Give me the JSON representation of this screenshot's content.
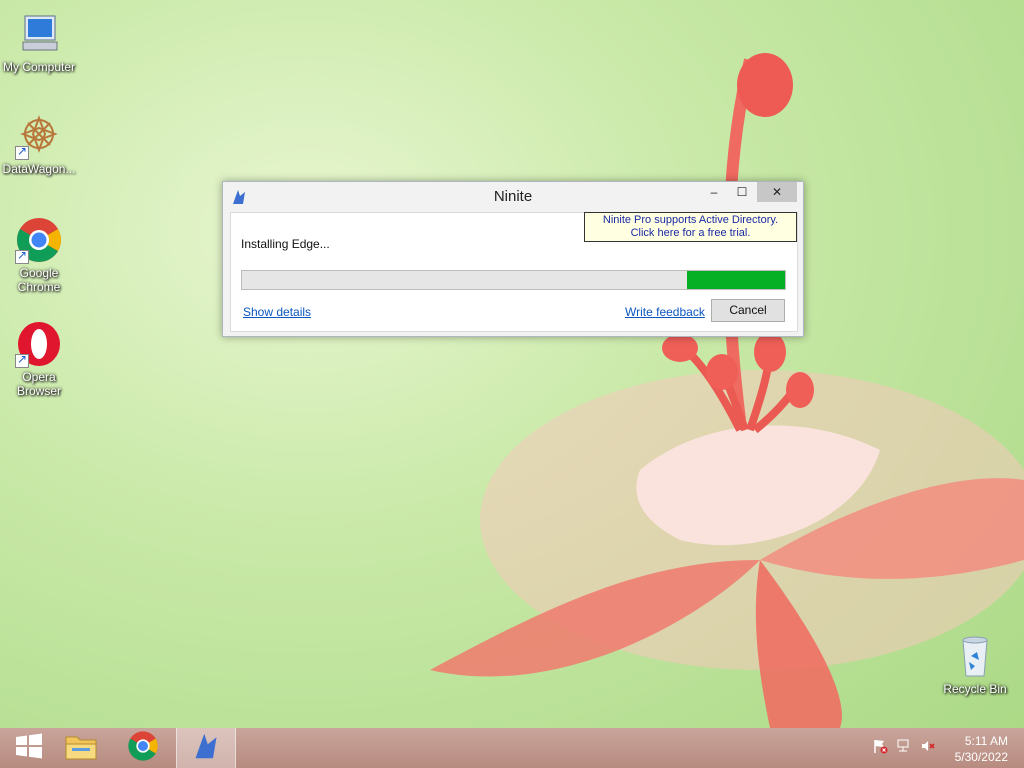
{
  "desktop": {
    "icons": [
      {
        "label": "My Computer"
      },
      {
        "label": "DataWagon..."
      },
      {
        "label": "Google Chrome"
      },
      {
        "label": "Opera Browser"
      },
      {
        "label": "Recycle Bin"
      }
    ]
  },
  "window": {
    "title": "Ninite",
    "minimize": "–",
    "maximize": "☐",
    "close": "✕",
    "promo_line1": "Ninite Pro supports Active Directory.",
    "promo_line2": "Click here for a free trial.",
    "status": "Installing Edge...",
    "progress_fraction": 0.18,
    "show_details": "Show details",
    "write_feedback": "Write feedback",
    "cancel": "Cancel"
  },
  "taskbar": {
    "clock_time": "5:11 AM",
    "clock_date": "5/30/2022",
    "items": [
      "start-icon",
      "file-explorer-icon",
      "chrome-icon",
      "ninite-icon"
    ]
  },
  "colors": {
    "progress_fill": "#06b025",
    "link": "#0b57c0",
    "taskbar": "#c09a90"
  }
}
